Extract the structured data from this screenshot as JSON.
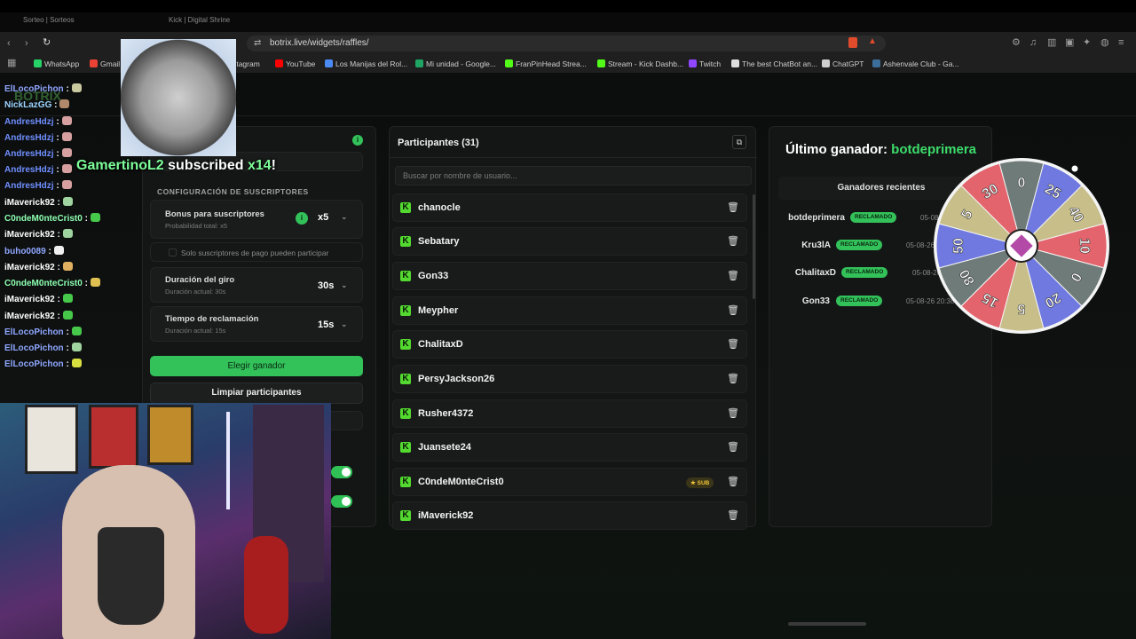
{
  "browser": {
    "tabs": [
      "Sorteo | Sorteos",
      "Kick | Digital Shrine"
    ],
    "url": "botrix.live/widgets/raffles/",
    "bookmarks": [
      "WhatsApp",
      "Gmail",
      "Instagram",
      "YouTube",
      "Los Manijas del Rol...",
      "Mi unidad - Google...",
      "FranPinHead Strea...",
      "Stream - Kick Dashb...",
      "Twitch",
      "The best ChatBot an...",
      "ChatGPT",
      "Ashenvale Club - Ga..."
    ]
  },
  "settings": {
    "section_title": "CONFIGURACIÓN DE SUSCRIPTORES",
    "bonus_label": "Bonus para suscriptores",
    "bonus_sub": "Probabilidad total: x5",
    "bonus_value": "x5",
    "only_subs_label": "Solo suscriptores de pago pueden participar",
    "spin_label": "Duración del giro",
    "spin_sub": "Duración actual: 30s",
    "spin_value": "30s",
    "claim_label": "Tiempo de reclamación",
    "claim_sub": "Duración actual: 15s",
    "claim_value": "15s",
    "pick_winner_button": "Elegir ganador",
    "clear_button": "Limpiar participantes"
  },
  "participants": {
    "title": "Participantes (31)",
    "search_placeholder": "Buscar por nombre de usuario...",
    "list": [
      {
        "name": "chanocle",
        "sub": false
      },
      {
        "name": "Sebatary",
        "sub": false
      },
      {
        "name": "Gon33",
        "sub": false
      },
      {
        "name": "Meypher",
        "sub": false
      },
      {
        "name": "ChalitaxD",
        "sub": false
      },
      {
        "name": "PersyJackson26",
        "sub": false
      },
      {
        "name": "Rusher4372",
        "sub": false
      },
      {
        "name": "Juansete24",
        "sub": false
      },
      {
        "name": "C0ndeM0nteCrist0",
        "sub": true
      },
      {
        "name": "iMaverick92",
        "sub": false
      }
    ],
    "sub_badge": "SUB"
  },
  "winners": {
    "last_winner_label": "Último ganador:",
    "last_winner_name": "botdeprimera",
    "recent_title": "Ganadores recientes",
    "claimed_label": "RECLAMADO",
    "list": [
      {
        "name": "botdeprimera",
        "date": "05-08-26 20:49"
      },
      {
        "name": "Kru3lA",
        "date": "05-08-26 20:47"
      },
      {
        "name": "ChalitaxD",
        "date": "05-08-26 20:41"
      },
      {
        "name": "Gon33",
        "date": "05-08-26 20:38"
      }
    ]
  },
  "wheel": {
    "labels": [
      "0",
      "25",
      "40",
      "10",
      "0",
      "20",
      "5",
      "15",
      "80",
      "50",
      "5",
      "30"
    ],
    "colors": [
      "#6e7b78",
      "#6f79e0",
      "#c7be8a",
      "#e3646c",
      "#6e7b78",
      "#6f79e0",
      "#c7be8a",
      "#e3646c",
      "#6e7b78",
      "#6f79e0",
      "#c7be8a",
      "#e3646c"
    ]
  },
  "overlay": {
    "watermark": "BOTRIX",
    "chat": [
      {
        "user": "ElLocoPichon",
        "color": "#8fa7ff"
      },
      {
        "user": "NickLazGG",
        "color": "#9bd3ff"
      },
      {
        "user": "AndresHdzj",
        "color": "#6f8fff"
      },
      {
        "user": "AndresHdzj",
        "color": "#6f8fff"
      },
      {
        "user": "AndresHdzj",
        "color": "#6f8fff"
      },
      {
        "user": "AndresHdzj",
        "color": "#6f8fff"
      },
      {
        "user": "AndresHdzj",
        "color": "#6f8fff"
      },
      {
        "user": "iMaverick92",
        "color": "#ffffff"
      },
      {
        "user": "C0ndeM0nteCrist0",
        "color": "#8cffb0"
      },
      {
        "user": "iMaverick92",
        "color": "#ffffff"
      },
      {
        "user": "buho0089",
        "color": "#8fa7ff"
      },
      {
        "user": "iMaverick92",
        "color": "#ffffff"
      },
      {
        "user": "C0ndeM0nteCrist0",
        "color": "#8cffb0"
      },
      {
        "user": "iMaverick92",
        "color": "#ffffff"
      },
      {
        "user": "iMaverick92",
        "color": "#ffffff"
      },
      {
        "user": "ElLocoPichon",
        "color": "#8fa7ff"
      },
      {
        "user": "ElLocoPichon",
        "color": "#8fa7ff"
      },
      {
        "user": "ElLocoPichon",
        "color": "#8fa7ff"
      }
    ],
    "sub_user": "GamertinoL2",
    "sub_text": "subscribed",
    "sub_count": "x14",
    "sub_exclaim": "!"
  }
}
